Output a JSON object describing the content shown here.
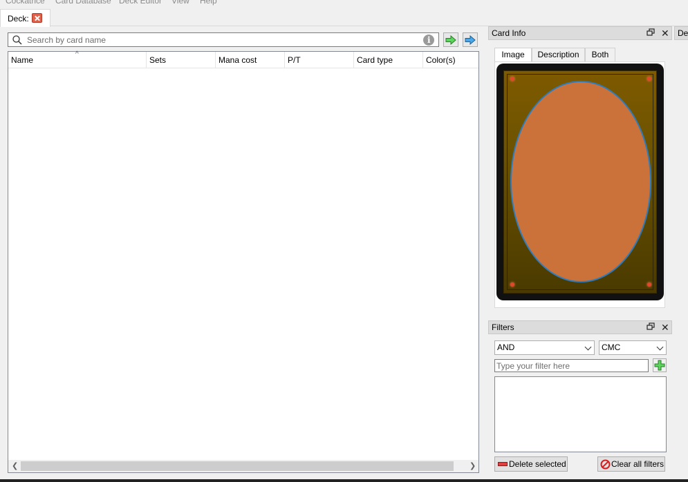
{
  "menu": [
    "Cockatrice",
    "Card Database",
    "Deck Editor",
    "View",
    "Help"
  ],
  "tab": {
    "label": "Deck:"
  },
  "search": {
    "placeholder": "Search by card name"
  },
  "table": {
    "columns": [
      "Name",
      "Sets",
      "Mana cost",
      "P/T",
      "Card type",
      "Color(s)"
    ],
    "sort_indicator": "^",
    "rows": []
  },
  "card_info": {
    "title": "Card Info",
    "tabs": [
      "Image",
      "Description",
      "Both"
    ],
    "active_tab": "Image"
  },
  "deck_dock": {
    "title": "De"
  },
  "filters": {
    "title": "Filters",
    "logic_select": "AND",
    "field_select": "CMC",
    "input_placeholder": "Type your filter here",
    "delete_label": "Delete selected",
    "clear_label": "Clear all filters"
  },
  "colors": {
    "card_oval": "#ca7239",
    "card_frame": "#7e5a00",
    "oval_border": "#2d7cc0",
    "tab_close": "#e0614a"
  },
  "icons": [
    "close-icon",
    "search-icon",
    "info-icon",
    "add-to-mainboard-icon",
    "add-to-sideboard-icon",
    "float-icon",
    "add-icon",
    "delete-icon",
    "clear-icon"
  ]
}
